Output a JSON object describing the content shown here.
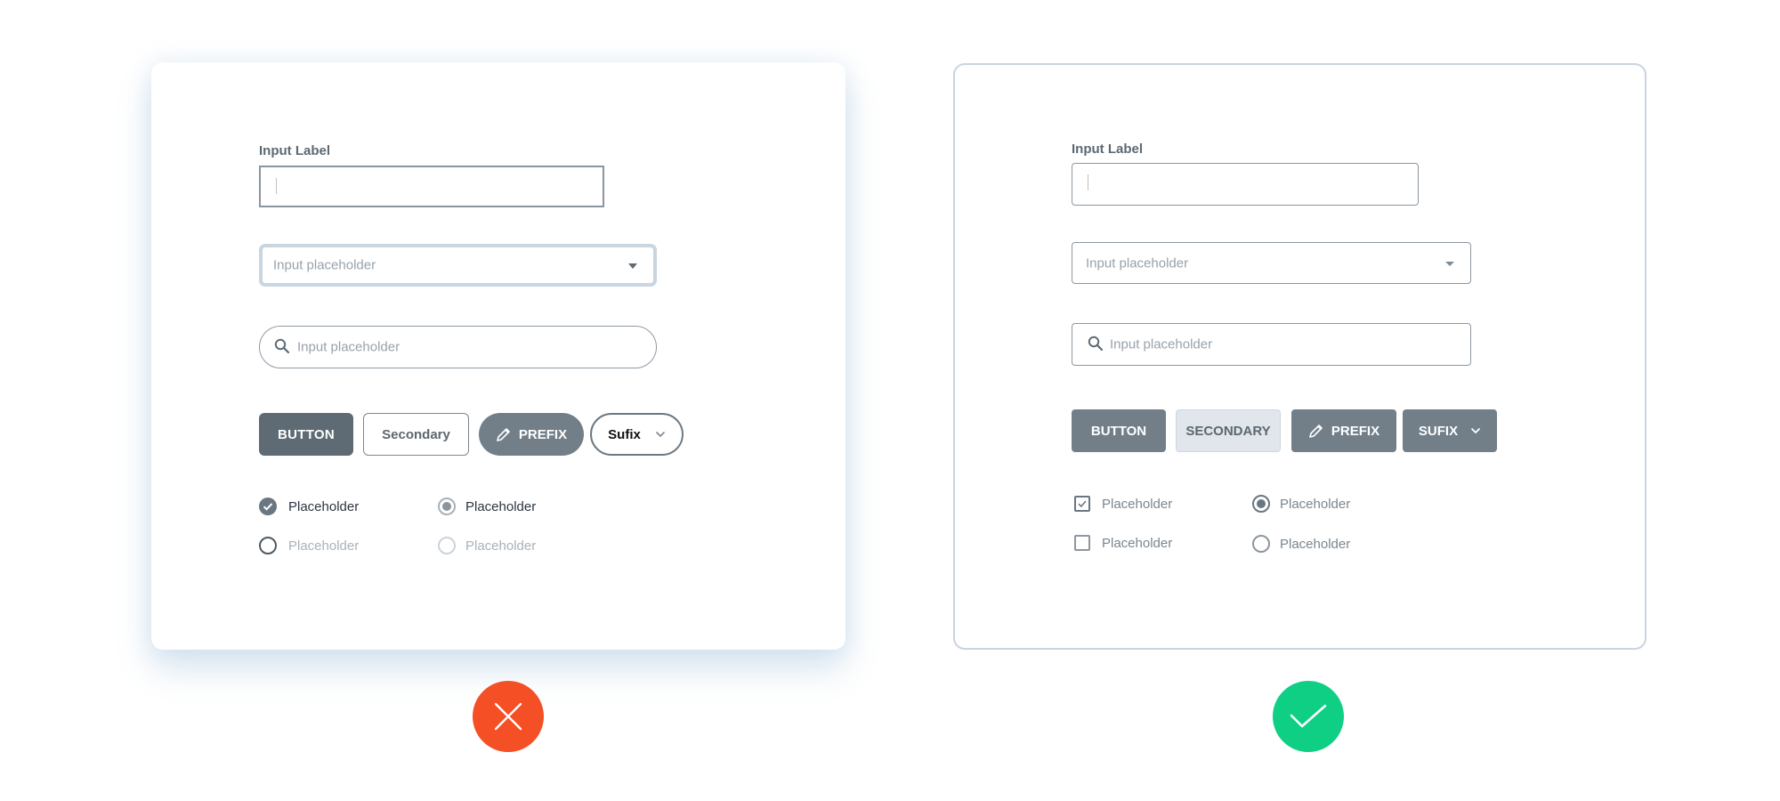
{
  "bad_example": {
    "input_label": "Input Label",
    "text_input_value": "",
    "select_placeholder": "Input placeholder",
    "search_placeholder": "Input placeholder",
    "buttons": {
      "primary": "BUTTON",
      "secondary": "Secondary",
      "prefix": "PREFIX",
      "suffix": "Sufix"
    },
    "options": [
      {
        "type": "checkbox-round",
        "label": "Placeholder",
        "checked": true
      },
      {
        "type": "radio",
        "label": "Placeholder",
        "checked": true
      },
      {
        "type": "checkbox-round",
        "label": "Placeholder",
        "checked": false
      },
      {
        "type": "radio",
        "label": "Placeholder",
        "checked": false
      }
    ],
    "verdict_icon": "x-icon",
    "verdict_color": "#f44f25"
  },
  "good_example": {
    "input_label": "Input Label",
    "text_input_value": "",
    "select_placeholder": "Input placeholder",
    "search_placeholder": "Input placeholder",
    "buttons": {
      "primary": "BUTTON",
      "secondary": "SECONDARY",
      "prefix": "PREFIX",
      "suffix": "SUFIX"
    },
    "options": [
      {
        "type": "checkbox",
        "label": "Placeholder",
        "checked": true
      },
      {
        "type": "radio",
        "label": "Placeholder",
        "checked": true
      },
      {
        "type": "checkbox",
        "label": "Placeholder",
        "checked": false
      },
      {
        "type": "radio",
        "label": "Placeholder",
        "checked": false
      }
    ],
    "verdict_icon": "check-icon",
    "verdict_color": "#0fcf84"
  },
  "icons": {
    "search": "search-icon",
    "dropdown": "caret-down-icon",
    "pencil": "pencil-icon",
    "chevron": "chevron-down-icon"
  }
}
